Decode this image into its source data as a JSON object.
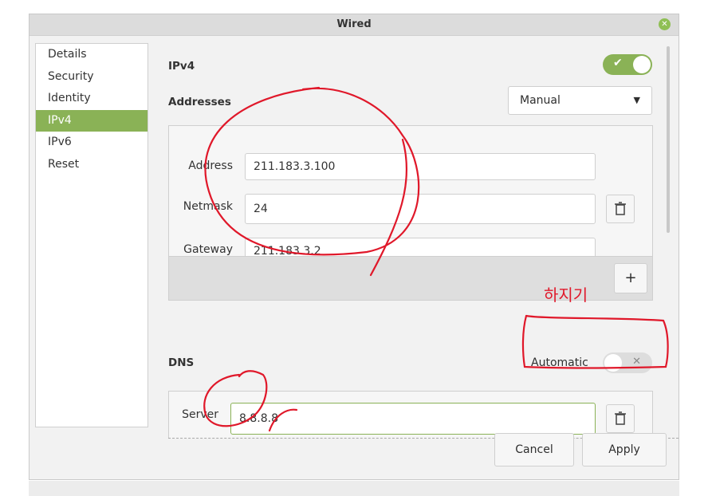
{
  "window": {
    "title": "Wired"
  },
  "sidebar": {
    "items": [
      {
        "label": "Details",
        "active": false
      },
      {
        "label": "Security",
        "active": false
      },
      {
        "label": "Identity",
        "active": false
      },
      {
        "label": "IPv4",
        "active": true
      },
      {
        "label": "IPv6",
        "active": false
      },
      {
        "label": "Reset",
        "active": false
      }
    ]
  },
  "ipv4": {
    "section_label": "IPv4",
    "enabled": true,
    "addresses_label": "Addresses",
    "method": "Manual",
    "fields": {
      "address_label": "Address",
      "address_value": "211.183.3.100",
      "netmask_label": "Netmask",
      "netmask_value": "24",
      "gateway_label": "Gateway",
      "gateway_value": "211.183.3.2"
    },
    "add_label": "+"
  },
  "dns": {
    "label": "DNS",
    "automatic_label": "Automatic",
    "automatic": false,
    "server_label": "Server",
    "server_value": "8.8.8.8"
  },
  "footer": {
    "cancel_label": "Cancel",
    "apply_label": "Apply"
  },
  "annotation": {
    "handwritten_text": "하지기",
    "ink_color": "#e0182a"
  },
  "colors": {
    "accent": "#8ab256"
  }
}
